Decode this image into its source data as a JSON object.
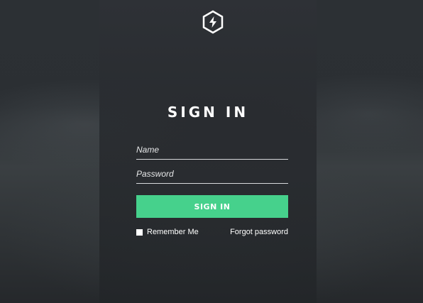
{
  "login": {
    "logo_icon": "lightning-hexagon-icon",
    "title": "SIGN IN",
    "name_placeholder": "Name",
    "password_placeholder": "Password",
    "submit_label": "SIGN IN",
    "remember_label": "Remember Me",
    "forgot_label": "Forgot password"
  },
  "colors": {
    "accent": "#46d18c",
    "panel": "#2e3136",
    "background": "#2a2d31"
  }
}
